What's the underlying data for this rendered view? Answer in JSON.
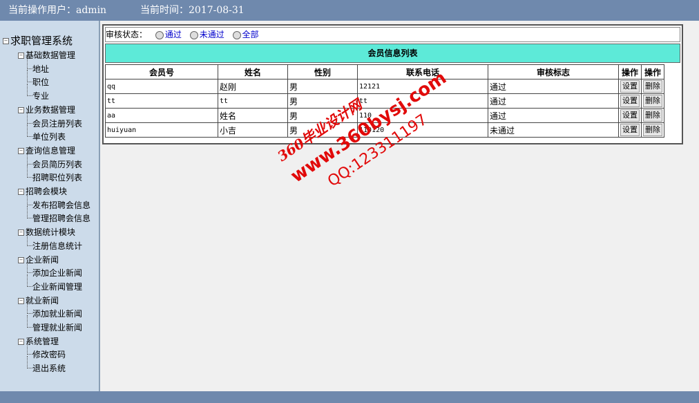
{
  "header": {
    "user_label": "当前操作用户：admin",
    "time_label": "当前时间：2017-08-31"
  },
  "sidebar": {
    "root": "求职管理系统",
    "groups": [
      {
        "label": "基础数据管理",
        "items": [
          "地址",
          "职位",
          "专业"
        ]
      },
      {
        "label": "业务数据管理",
        "items": [
          "会员注册列表",
          "单位列表"
        ]
      },
      {
        "label": "查询信息管理",
        "items": [
          "会员简历列表",
          "招聘职位列表"
        ]
      },
      {
        "label": "招聘会模块",
        "items": [
          "发布招聘会信息",
          "管理招聘会信息"
        ]
      },
      {
        "label": "数据统计模块",
        "items": [
          "注册信息统计"
        ]
      },
      {
        "label": "企业新闻",
        "items": [
          "添加企业新闻",
          "企业新闻管理"
        ]
      },
      {
        "label": "就业新闻",
        "items": [
          "添加就业新闻",
          "管理就业新闻"
        ]
      },
      {
        "label": "系统管理",
        "items": [
          "修改密码",
          "退出系统"
        ]
      }
    ]
  },
  "filter": {
    "label": "审核状态：",
    "options": [
      "通过",
      "未通过",
      "全部"
    ]
  },
  "table": {
    "title": "会员信息列表",
    "headers": [
      "会员号",
      "姓名",
      "性别",
      "联系电话",
      "审核标志",
      "操作",
      "操作"
    ],
    "rows": [
      {
        "id": "qq",
        "name": "赵刚",
        "gender": "男",
        "phone": "12121",
        "status": "通过"
      },
      {
        "id": "tt",
        "name": "tt",
        "gender": "男",
        "phone": "tt",
        "status": "通过"
      },
      {
        "id": "aa",
        "name": "姓名",
        "gender": "男",
        "phone": "110",
        "status": "通过"
      },
      {
        "id": "huiyuan",
        "name": "小吉",
        "gender": "男",
        "phone": "110120",
        "status": "未通过"
      }
    ],
    "action_set": "设置",
    "action_delete": "删除"
  },
  "watermark": {
    "line1": "360毕业设计网",
    "line2": "www.360bysj.com",
    "line3": "QQ:123311197"
  }
}
